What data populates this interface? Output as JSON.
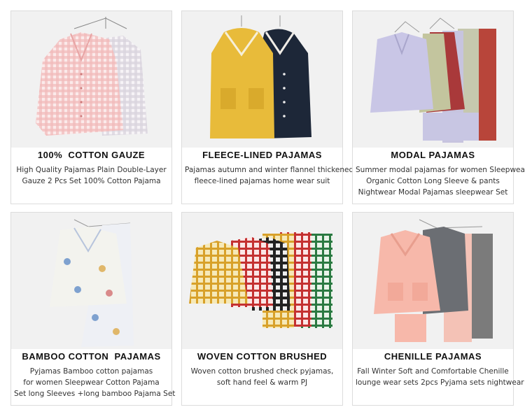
{
  "products": [
    {
      "title": "100%  COTTON GAUZE",
      "lines": [
        "High Quality Pajamas Plain Double-Layer",
        "Gauze 2 Pcs Set 100% Cotton  Pajama"
      ],
      "image_icon": "gingham-shirts-icon"
    },
    {
      "title": "FLEECE-LINED PAJAMAS",
      "lines": [
        "Pajamas  autumn and winter flannel thickened",
        "fleece-lined pajamas home wear suit"
      ],
      "image_icon": "fleece-robes-icon"
    },
    {
      "title": "MODAL PAJAMAS",
      "lines": [
        "Summer modal pajamas for women Sleepwear",
        "Organic Cotton Long Sleeve & pants",
        "Nightwear Modal Pajamas sleepwear Set"
      ],
      "image_icon": "modal-set-icon"
    },
    {
      "title": "BAMBOO COTTON  PAJAMAS",
      "lines": [
        "Pyjamas Bamboo cotton pajamas",
        "for women Sleepwear Cotton Pajama",
        "Set long Sleeves +long bamboo Pajama Set"
      ],
      "image_icon": "bamboo-set-icon"
    },
    {
      "title": "WOVEN COTTON BRUSHED",
      "lines": [
        "Woven cotton brushed check pyjamas,",
        "soft hand feel & warm PJ"
      ],
      "image_icon": "plaid-set-icon"
    },
    {
      "title": "CHENILLE PAJAMAS",
      "lines": [
        "Fall Winter Soft and Comfortable Chenille",
        "lounge wear sets 2pcs Pyjama sets nightwear"
      ],
      "image_icon": "chenille-set-icon"
    }
  ]
}
